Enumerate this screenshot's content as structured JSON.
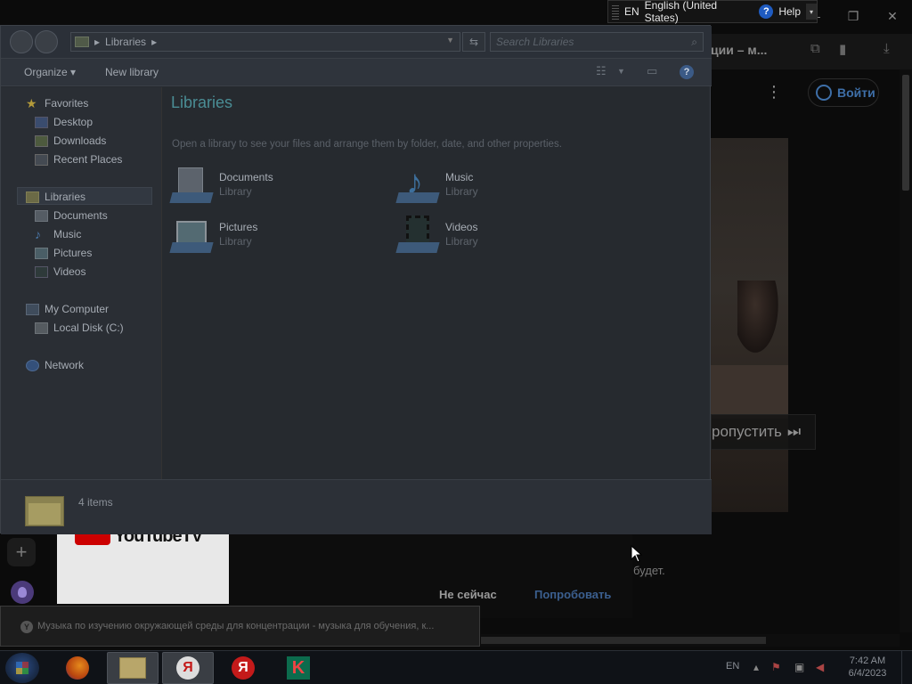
{
  "browser": {
    "tab_title": "ции – м...",
    "login_label": "Войти",
    "skip_label": "ропустить",
    "promo_text": "будет.",
    "not_now_label": "Не сейчас",
    "try_label": "Попробовать",
    "yt_logo_text": "YouTubeTV"
  },
  "notification": {
    "text": "Музыка по изучению окружающей среды для концентрации - музыка для обучения, к..."
  },
  "language_bar": {
    "lang_code": "EN",
    "lang_name": "English (United States)",
    "help_label": "Help"
  },
  "explorer": {
    "address": "Libraries",
    "search_placeholder": "Search Libraries",
    "toolbar": {
      "organize_label": "Organize ▾",
      "new_library_label": "New library"
    },
    "nav": {
      "favorites": "Favorites",
      "desktop": "Desktop",
      "downloads": "Downloads",
      "recent_places": "Recent Places",
      "libraries": "Libraries",
      "documents": "Documents",
      "music": "Music",
      "pictures": "Pictures",
      "videos": "Videos",
      "my_computer": "My Computer",
      "local_disk": "Local Disk (C:)",
      "network": "Network"
    },
    "content": {
      "title": "Libraries",
      "subtitle": "Open a library to see your files and arrange them by folder, date, and other properties.",
      "items": [
        {
          "name": "Documents",
          "type": "Library"
        },
        {
          "name": "Music",
          "type": "Library"
        },
        {
          "name": "Pictures",
          "type": "Library"
        },
        {
          "name": "Videos",
          "type": "Library"
        }
      ]
    },
    "details": {
      "item_count": "4 items"
    }
  },
  "taskbar": {
    "tray_lang": "EN",
    "time": "7:42 AM",
    "date": "6/4/2023",
    "yandex_letter": "Я",
    "kaspersky_letter": "K"
  },
  "colors": {
    "library_title": "#4a8d95",
    "help_blue": "#1f5bc0",
    "yandex_red": "#c41a1a"
  }
}
